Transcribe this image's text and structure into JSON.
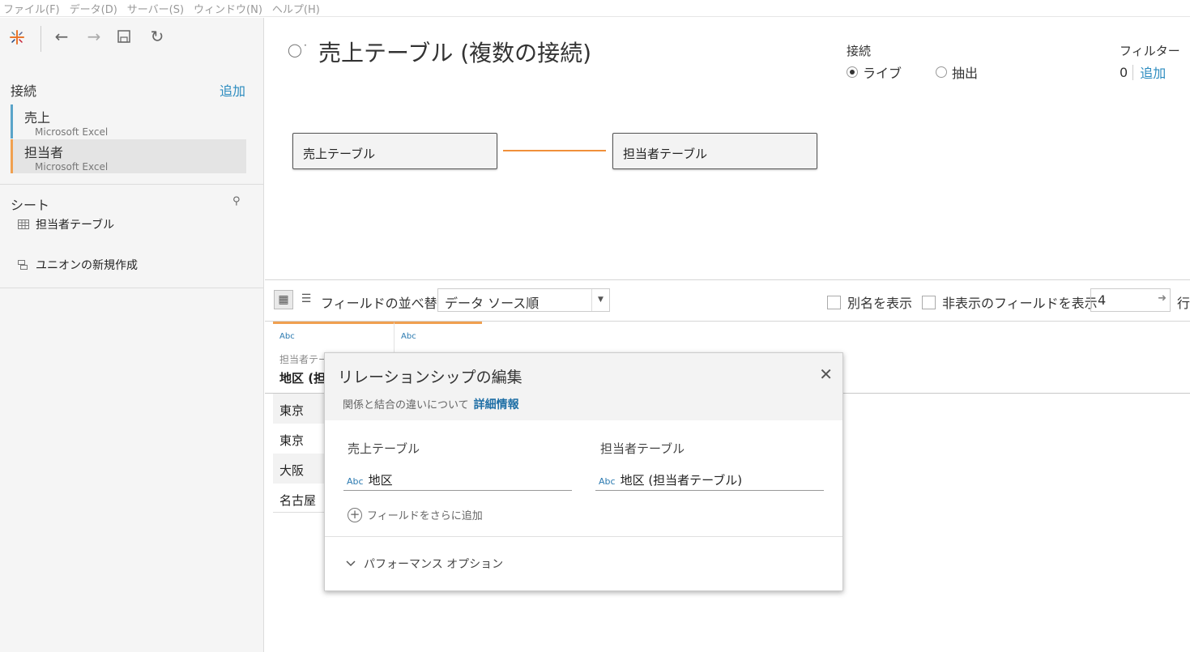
{
  "menu": [
    "ファイル(F)",
    "データ(D)",
    "サーバー(S)",
    "ウィンドウ(N)",
    "ヘルプ(H)"
  ],
  "left": {
    "connections_label": "接続",
    "add_label": "追加",
    "connections": [
      {
        "name": "売上",
        "type": "Microsoft Excel"
      },
      {
        "name": "担当者",
        "type": "Microsoft Excel"
      }
    ],
    "sheets_label": "シート",
    "sheets": [
      {
        "name": "担当者テーブル"
      },
      {
        "name": "ユニオンの新規作成"
      }
    ]
  },
  "header": {
    "title": "売上テーブル (複数の接続)",
    "connection_label": "接続",
    "live_label": "ライブ",
    "extract_label": "抽出",
    "filter_label": "フィルター",
    "filter_count": "0",
    "filter_add": "追加"
  },
  "canvas": {
    "left_table": "売上テーブル",
    "right_table": "担当者テーブル",
    "line_color": "#f0903a"
  },
  "grid_toolbar": {
    "sort_label": "フィールドの並べ替え",
    "sort_value": "データ ソース順",
    "show_alias": "別名を表示",
    "show_hidden": "非表示のフィールドを表示",
    "rows_value": "4",
    "rows_label": "行"
  },
  "grid": {
    "columns": [
      {
        "type": "Abc",
        "source": "担当者テーブル",
        "name": "地区 (担当者テーブル)"
      },
      {
        "type": "Abc",
        "source": "",
        "name": ""
      }
    ],
    "rows": [
      "東京",
      "東京",
      "大阪",
      "名古屋"
    ]
  },
  "dialog": {
    "title": "リレーションシップの編集",
    "info_text": "関係と結合の違いについて",
    "info_link": "詳細情報",
    "left_table": "売上テーブル",
    "right_table": "担当者テーブル",
    "left_field_type": "Abc",
    "left_field": "地区",
    "right_field_type": "Abc",
    "right_field": "地区 (担当者テーブル)",
    "add_more": "フィールドをさらに追加",
    "perf_options": "パフォーマンス オプション"
  }
}
